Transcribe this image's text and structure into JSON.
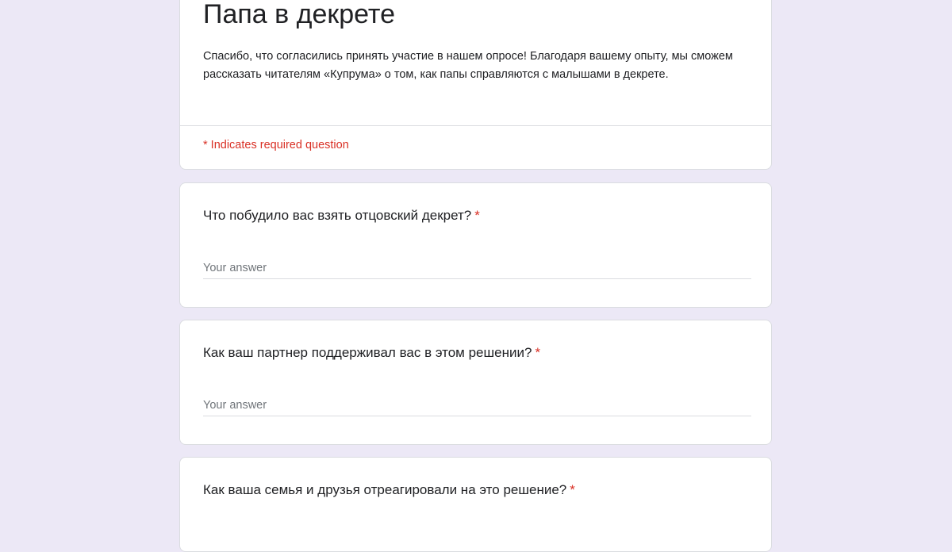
{
  "form": {
    "title": "Папа в декрете",
    "description": "Спасибо, что согласились принять участие в нашем опросе! Благодаря вашему опыту, мы сможем рассказать читателям «Купрума» о том, как папы справляются с малышами в декрете.",
    "required_note": "* Indicates required question"
  },
  "questions": [
    {
      "title": "Что побудило вас взять отцовский декрет?",
      "required_marker": "*",
      "answer_placeholder": "Your answer",
      "answer_value": ""
    },
    {
      "title": "Как ваш партнер поддерживал вас в этом решении?",
      "required_marker": "*",
      "answer_placeholder": "Your answer",
      "answer_value": ""
    },
    {
      "title": "Как ваша семья и друзья отреагировали на это решение?",
      "required_marker": "*"
    }
  ],
  "colors": {
    "background": "#ece8f6",
    "card": "#ffffff",
    "required": "#d93025",
    "text": "#202124",
    "placeholder": "#70757a",
    "divider": "#dadce0"
  }
}
